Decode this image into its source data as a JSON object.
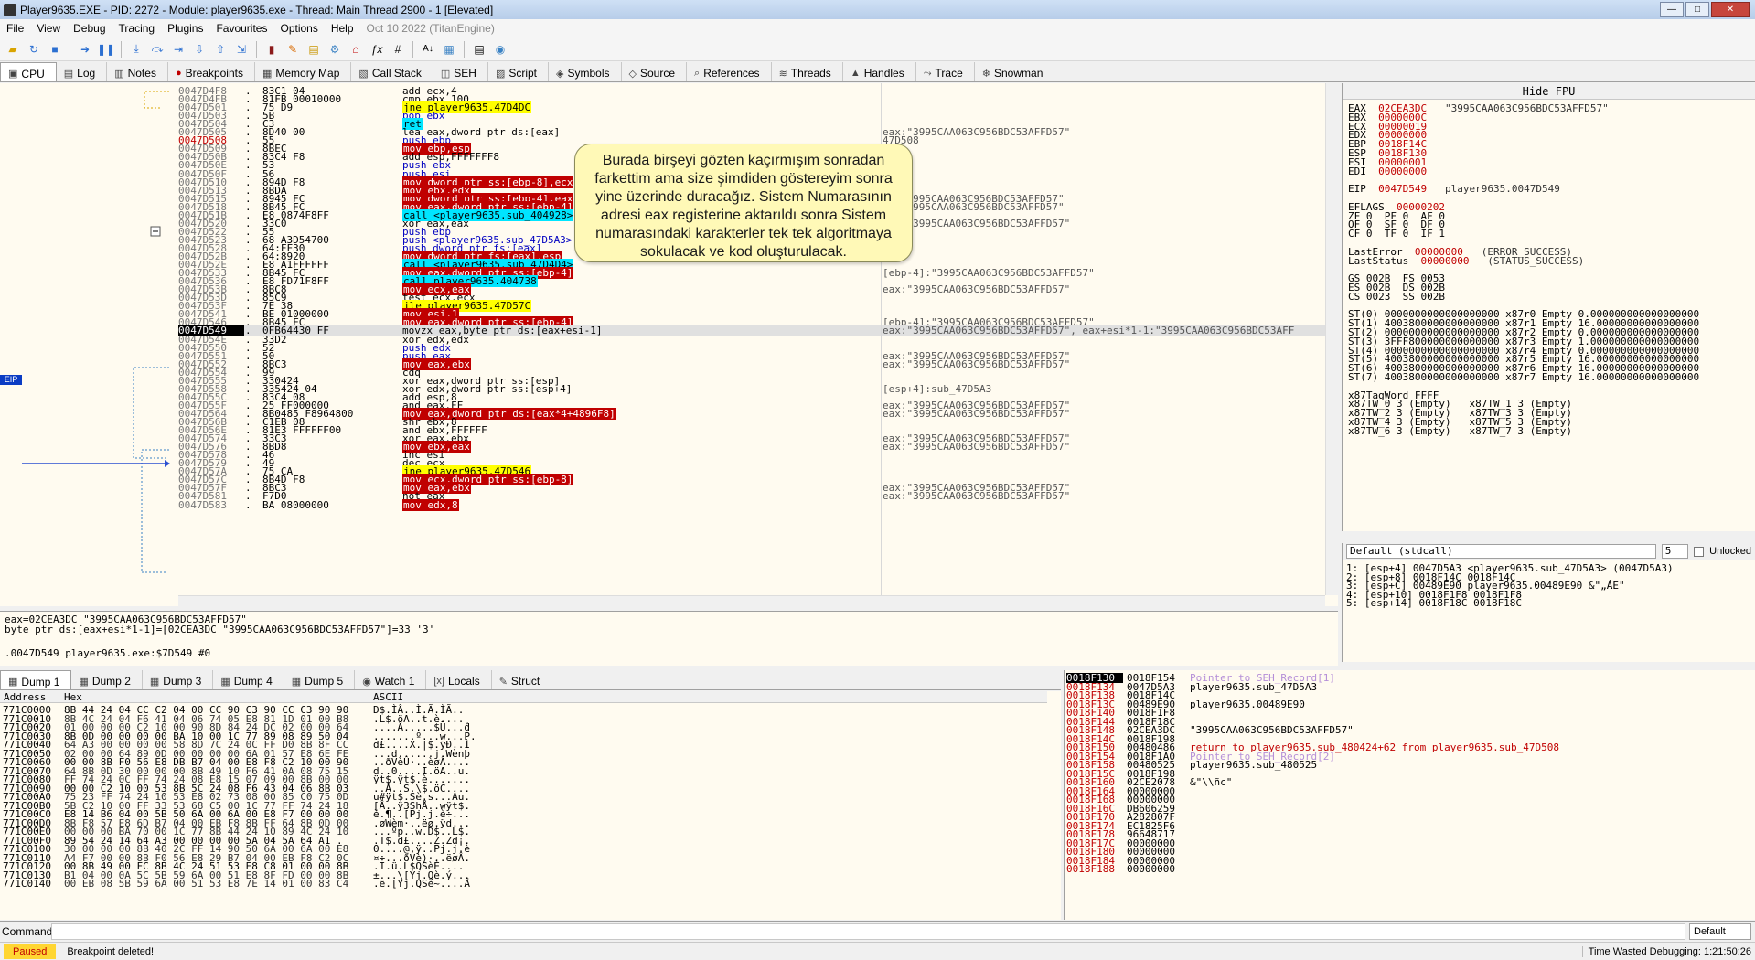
{
  "window": {
    "title": "Player9635.EXE - PID: 2272 - Module: player9635.exe - Thread: Main Thread 2900 - 1 [Elevated]"
  },
  "menu": [
    "File",
    "View",
    "Debug",
    "Tracing",
    "Plugins",
    "Favourites",
    "Options",
    "Help",
    "Oct 10 2022 (TitanEngine)"
  ],
  "tabs": [
    "CPU",
    "Log",
    "Notes",
    "Breakpoints",
    "Memory Map",
    "Call Stack",
    "SEH",
    "Script",
    "Symbols",
    "Source",
    "References",
    "Threads",
    "Handles",
    "Trace",
    "Snowman"
  ],
  "disasm": {
    "eip_label": "EIP",
    "rows": [
      {
        "a": "0047D4F8",
        "b": "83C1 04",
        "i": "add ecx,4",
        "c": ""
      },
      {
        "a": "0047D4FB",
        "b": "81FB 00010000",
        "i": "cmp ebx,100",
        "c": ""
      },
      {
        "a": "0047D501",
        "b": "75 D9",
        "i": "jne player9635.47D4DC",
        "c": "",
        "t": "jmp"
      },
      {
        "a": "0047D503",
        "b": "5B",
        "i": "pop ebx",
        "c": "",
        "t": "push"
      },
      {
        "a": "0047D504",
        "b": "C3",
        "i": "ret",
        "c": "",
        "t": "ret"
      },
      {
        "a": "0047D505",
        "b": "8D40 00",
        "i": "lea eax,dword ptr ds:[eax]",
        "c": "eax:\"3995CAA063C956BDC53AFFD57\""
      },
      {
        "a": "0047D508",
        "b": "55",
        "i": "push ebp",
        "c": "47D508",
        "t": "push",
        "red": true
      },
      {
        "a": "0047D509",
        "b": "8BEC",
        "i": "mov ebp,esp",
        "c": "",
        "t": "mov"
      },
      {
        "a": "0047D50B",
        "b": "83C4 F8",
        "i": "add esp,FFFFFFF8",
        "c": ""
      },
      {
        "a": "0047D50E",
        "b": "53",
        "i": "push ebx",
        "c": "",
        "t": "push"
      },
      {
        "a": "0047D50F",
        "b": "56",
        "i": "push esi",
        "c": "",
        "t": "push"
      },
      {
        "a": "0047D510",
        "b": "894D F8",
        "i": "mov dword ptr ss:[ebp-8],ecx",
        "c": "",
        "t": "mov"
      },
      {
        "a": "0047D513",
        "b": "8BDA",
        "i": "mov ebx,edx",
        "c": "",
        "t": "mov"
      },
      {
        "a": "0047D515",
        "b": "8945 FC",
        "i": "mov dword ptr ss:[ebp-4],eax",
        "c": "4]:\"3995CAA063C956BDC53AFFD57\"",
        "t": "mov"
      },
      {
        "a": "0047D518",
        "b": "8B45 FC",
        "i": "mov eax,dword ptr ss:[ebp-4]",
        "c": "4]:\"3995CAA063C956BDC53AFFD57\"",
        "t": "mov"
      },
      {
        "a": "0047D51B",
        "b": "E8 0874F8FF",
        "i": "call <player9635.sub_404928>",
        "c": "",
        "t": "call"
      },
      {
        "a": "0047D520",
        "b": "33C0",
        "i": "xor eax,eax",
        "c": "eax:\"3995CAA063C956BDC53AFFD57\""
      },
      {
        "a": "0047D522",
        "b": "55",
        "i": "push ebp",
        "c": "",
        "t": "push"
      },
      {
        "a": "0047D523",
        "b": "68 A3D54700",
        "i": "push <player9635.sub_47D5A3>",
        "c": "",
        "t": "push"
      },
      {
        "a": "0047D528",
        "b": "64:FF30",
        "i": "push dword ptr fs:[eax]",
        "c": "",
        "t": "push"
      },
      {
        "a": "0047D52B",
        "b": "64:8920",
        "i": "mov dword ptr fs:[eax],esp",
        "c": "",
        "t": "mov"
      },
      {
        "a": "0047D52E",
        "b": "E8 A1FFFFFF",
        "i": "call <player9635.sub_47D4D4>",
        "c": "",
        "t": "call"
      },
      {
        "a": "0047D533",
        "b": "8B45 FC",
        "i": "mov eax,dword ptr ss:[ebp-4]",
        "c": "[ebp-4]:\"3995CAA063C956BDC53AFFD57\"",
        "t": "mov"
      },
      {
        "a": "0047D536",
        "b": "E8 FD71F8FF",
        "i": "call player9635.404738",
        "c": "",
        "t": "call"
      },
      {
        "a": "0047D53B",
        "b": "8BC8",
        "i": "mov ecx,eax",
        "c": "eax:\"3995CAA063C956BDC53AFFD57\"",
        "t": "mov"
      },
      {
        "a": "0047D53D",
        "b": "85C9",
        "i": "test ecx,ecx",
        "c": ""
      },
      {
        "a": "0047D53F",
        "b": "7E 38",
        "i": "jle player9635.47D57C",
        "c": "",
        "t": "jmp"
      },
      {
        "a": "0047D541",
        "b": "BE 01000000",
        "i": "mov esi,1",
        "c": "",
        "t": "mov"
      },
      {
        "a": "0047D546",
        "b": "8B45 FC",
        "i": "mov eax,dword ptr ss:[ebp-4]",
        "c": "[ebp-4]:\"3995CAA063C956BDC53AFFD57\"",
        "t": "mov"
      },
      {
        "a": "0047D549",
        "b": "0FB64430 FF",
        "i": "movzx eax,byte ptr ds:[eax+esi-1]",
        "c": "eax:\"3995CAA063C956BDC53AFFD57\", eax+esi*1-1:\"3995CAA063C956BDC53AFF",
        "cur": true
      },
      {
        "a": "0047D54E",
        "b": "33D2",
        "i": "xor edx,edx",
        "c": ""
      },
      {
        "a": "0047D550",
        "b": "52",
        "i": "push edx",
        "c": "",
        "t": "push"
      },
      {
        "a": "0047D551",
        "b": "50",
        "i": "push eax",
        "c": "eax:\"3995CAA063C956BDC53AFFD57\"",
        "t": "push"
      },
      {
        "a": "0047D552",
        "b": "8BC3",
        "i": "mov eax,ebx",
        "c": "eax:\"3995CAA063C956BDC53AFFD57\"",
        "t": "mov"
      },
      {
        "a": "0047D554",
        "b": "99",
        "i": "cdq",
        "c": ""
      },
      {
        "a": "0047D555",
        "b": "330424",
        "i": "xor eax,dword ptr ss:[esp]",
        "c": ""
      },
      {
        "a": "0047D558",
        "b": "335424 04",
        "i": "xor edx,dword ptr ss:[esp+4]",
        "c": "[esp+4]:sub_47D5A3"
      },
      {
        "a": "0047D55C",
        "b": "83C4 08",
        "i": "add esp,8",
        "c": ""
      },
      {
        "a": "0047D55F",
        "b": "25 FF000000",
        "i": "and eax,FF",
        "c": "eax:\"3995CAA063C956BDC53AFFD57\""
      },
      {
        "a": "0047D564",
        "b": "8B0485 F8964800",
        "i": "mov eax,dword ptr ds:[eax*4+4896F8]",
        "c": "eax:\"3995CAA063C956BDC53AFFD57\"",
        "t": "mov"
      },
      {
        "a": "0047D56B",
        "b": "C1EB 08",
        "i": "shr ebx,8",
        "c": ""
      },
      {
        "a": "0047D56E",
        "b": "81E3 FFFFFF00",
        "i": "and ebx,FFFFFF",
        "c": ""
      },
      {
        "a": "0047D574",
        "b": "33C3",
        "i": "xor eax,ebx",
        "c": "eax:\"3995CAA063C956BDC53AFFD57\""
      },
      {
        "a": "0047D576",
        "b": "8BD8",
        "i": "mov ebx,eax",
        "c": "eax:\"3995CAA063C956BDC53AFFD57\"",
        "t": "mov"
      },
      {
        "a": "0047D578",
        "b": "46",
        "i": "inc esi",
        "c": ""
      },
      {
        "a": "0047D579",
        "b": "49",
        "i": "dec ecx",
        "c": ""
      },
      {
        "a": "0047D57A",
        "b": "75 CA",
        "i": "jne player9635.47D546",
        "c": "",
        "t": "jmp"
      },
      {
        "a": "0047D57C",
        "b": "8B4D F8",
        "i": "mov ecx,dword ptr ss:[ebp-8]",
        "c": "",
        "t": "mov"
      },
      {
        "a": "0047D57F",
        "b": "8BC3",
        "i": "mov eax,ebx",
        "c": "eax:\"3995CAA063C956BDC53AFFD57\"",
        "t": "mov"
      },
      {
        "a": "0047D581",
        "b": "F7D0",
        "i": "not eax",
        "c": "eax:\"3995CAA063C956BDC53AFFD57\""
      },
      {
        "a": "0047D583",
        "b": "BA 08000000",
        "i": "mov edx,8",
        "c": "",
        "t": "mov"
      }
    ]
  },
  "callout": {
    "text": "Burada birşeyi gözten kaçırmışım sonradan farkettim ama size şimdiden göstereyim sonra yine üzerinde duracağız. Sistem Numarasının adresi eax registerine aktarıldı sonra Sistem numarasındaki karakterler tek tek algoritmaya sokulacak ve kod oluşturulacak."
  },
  "registers": {
    "hide_fpu": "Hide FPU",
    "lines": [
      [
        "EAX",
        "02CEA3DC",
        "\"3995CAA063C956BDC53AFFD57\""
      ],
      [
        "EBX",
        "0000000C",
        ""
      ],
      [
        "ECX",
        "00000019",
        ""
      ],
      [
        "EDX",
        "00000000",
        ""
      ],
      [
        "EBP",
        "0018F14C",
        ""
      ],
      [
        "ESP",
        "0018F130",
        ""
      ],
      [
        "ESI",
        "00000001",
        ""
      ],
      [
        "EDI",
        "00000000",
        ""
      ],
      [
        "",
        "",
        ""
      ],
      [
        "EIP",
        "0047D549",
        "player9635.0047D549"
      ],
      [
        "",
        "",
        ""
      ],
      [
        "EFLAGS",
        "00000202",
        ""
      ],
      [
        "ZF 0  PF 0  AF 0",
        "",
        ""
      ],
      [
        "OF 0  SF 0  DF 0",
        "",
        ""
      ],
      [
        "CF 0  TF 0  IF 1",
        "",
        ""
      ],
      [
        "",
        "",
        ""
      ],
      [
        "LastError",
        "00000000",
        "(ERROR_SUCCESS)"
      ],
      [
        "LastStatus",
        "00000000",
        "(STATUS_SUCCESS)"
      ],
      [
        "",
        "",
        ""
      ],
      [
        "GS 002B  FS 0053",
        "",
        ""
      ],
      [
        "ES 002B  DS 002B",
        "",
        ""
      ],
      [
        "CS 0023  SS 002B",
        "",
        ""
      ],
      [
        "",
        "",
        ""
      ],
      [
        "ST(0) 0000000000000000000 x87r0 Empty 0.000000000000000000",
        "",
        ""
      ],
      [
        "ST(1) 4003800000000000000 x87r1 Empty 16.00000000000000000",
        "",
        ""
      ],
      [
        "ST(2) 0000000000000000000 x87r2 Empty 0.000000000000000000",
        "",
        ""
      ],
      [
        "ST(3) 3FFF800000000000000 x87r3 Empty 1.000000000000000000",
        "",
        ""
      ],
      [
        "ST(4) 0000000000000000000 x87r4 Empty 0.000000000000000000",
        "",
        ""
      ],
      [
        "ST(5) 4003800000000000000 x87r5 Empty 16.00000000000000000",
        "",
        ""
      ],
      [
        "ST(6) 4003800000000000000 x87r6 Empty 16.00000000000000000",
        "",
        ""
      ],
      [
        "ST(7) 4003800000000000000 x87r7 Empty 16.00000000000000000",
        "",
        ""
      ],
      [
        "",
        "",
        ""
      ],
      [
        "x87TagWord FFFF",
        "",
        ""
      ],
      [
        "x87TW_0 3 (Empty)   x87TW_1 3 (Empty)",
        "",
        ""
      ],
      [
        "x87TW_2 3 (Empty)   x87TW_3 3 (Empty)",
        "",
        ""
      ],
      [
        "x87TW_4 3 (Empty)   x87TW_5 3 (Empty)",
        "",
        ""
      ],
      [
        "x87TW_6 3 (Empty)   x87TW_7 3 (Empty)",
        "",
        ""
      ]
    ]
  },
  "callconv": {
    "selected": "Default (stdcall)",
    "count": "5",
    "unlocked": "Unlocked",
    "lines": [
      "1: [esp+4] 0047D5A3 <player9635.sub_47D5A3> (0047D5A3)",
      "2: [esp+8] 0018F14C 0018F14C",
      "3: [esp+C] 00489E90 player9635.00489E90 &\"„ÁE\"",
      "4: [esp+10] 0018F1F8 0018F1F8",
      "5: [esp+14] 0018F18C 0018F18C"
    ]
  },
  "info": {
    "line1": "eax=02CEA3DC \"3995CAA063C956BDC53AFFD57\"",
    "line2": "byte ptr ds:[eax+esi*1-1]=[02CEA3DC \"3995CAA063C956BDC53AFFD57\"]=33 '3'",
    "line3": ".0047D549 player9635.exe:$7D549 #0"
  },
  "dump_tabs": [
    "Dump 1",
    "Dump 2",
    "Dump 3",
    "Dump 4",
    "Dump 5",
    "Watch 1",
    "Locals",
    "Struct"
  ],
  "dump": {
    "hdr_addr": "Address",
    "hdr_hex": "Hex",
    "hdr_ascii": "ASCII",
    "rows": [
      [
        "771C0000",
        "8B 44 24 04 CC C2 04 00 CC 90 C3 90 CC C3 90 90",
        "D$.ÌÂ..Ì.Ã.ÌÃ.."
      ],
      [
        "771C0010",
        "8B 4C 24 04 F6 41 04 06 74 05 E8 81 1D 01 00 B8",
        ".L$.öA..t.è....¸"
      ],
      [
        "771C0020",
        "01 00 00 00 C2 10 00 90 8D 84 24 DC 02 00 00 64",
        "....Â.....$Ü...d"
      ],
      [
        "771C0030",
        "8B 0D 00 00 00 00 BA 10 00 1C 77 89 08 89 50 04",
        ".......º...w...P."
      ],
      [
        "771C0040",
        "64 A3 00 00 00 00 58 8D 7C 24 0C FF D0 8B 8F CC",
        "d£....X.|$.ÿÐ..Ì"
      ],
      [
        "771C0050",
        "02 00 00 64 89 0D 00 00 00 00 6A 01 57 E8 6E FE",
        "...d......j.Wènþ"
      ],
      [
        "771C0060",
        "00 00 8B F0 56 E8 DB B7 04 00 E8 F8 C2 10 00 90",
        "..ðVèÛ·..èøÂ...."
      ],
      [
        "771C0070",
        "64 8B 0D 30 00 00 00 8B 49 10 F6 41 0A 08 75 15",
        "d..0....I.öA..u."
      ],
      [
        "771C0080",
        "FF 74 24 0C FF 74 24 08 E8 15 07 09 00 8B 00 00",
        "ÿt$.ÿt$.è......."
      ],
      [
        "771C0090",
        "00 00 C2 10 00 53 8B 5C 24 08 F6 43 04 06 8B 03",
        "..Â..S.\\$.öC...."
      ],
      [
        "771C00A0",
        "75 23 FF 74 24 10 53 E8 02 73 08 00 85 C0 75 0D",
        "u#ÿt$.Sè.s...Àu."
      ],
      [
        "771C00B0",
        "5B C2 10 00 FF 33 53 68 C5 00 1C 77 FF 74 24 18",
        "[Â..ÿ3ShÅ..wÿt$."
      ],
      [
        "771C00C0",
        "E8 14 B6 04 00 5B 50 6A 00 6A 00 E8 F7 00 00 00",
        "è.¶..[Pj.j.è÷..."
      ],
      [
        "771C00D0",
        "8B F8 57 E8 6D B7 04 00 EB F8 8B FF 64 8B 0D 00",
        ".øWèm·..ëø.ÿd..."
      ],
      [
        "771C00E0",
        "00 00 00 BA 70 00 1C 77 8B 44 24 10 89 4C 24 10",
        "...ºp..w.D$..L$."
      ],
      [
        "771C00F0",
        "89 54 24 14 64 A3 00 00 00 00 5A 04 5A 64 A1 .",
        ".T$.d£....Z.Zd¡."
      ],
      [
        "771C0100",
        "30 00 00 00 8B 40 2C FF 14 90 50 6A 00 6A 00 E8",
        "0....@,ÿ..Pj.j.è"
      ],
      [
        "771C0110",
        "A4 F7 00 00 8B F0 56 E8 29 B7 04 00 EB F8 C2 0C",
        "¤÷...ðVè)·..ëøÂ."
      ],
      [
        "771C0120",
        "00 8B 49 00 FC 8B 4C 24 51 53 E8 C8 01 00 00 8B",
        ".I.ü.L$QSèÈ...."
      ],
      [
        "771C0130",
        "B1 04 00 0A 5C 5B 59 6A 00 51 E8 8F FD 00 00 8B",
        "±...\\[Yj.Qè.ý..."
      ],
      [
        "771C0140",
        "00 EB 08 5B 59 6A 00 51 53 E8 7E 14 01 00 83 C4",
        ".ë.[Yj.QSè~....Ä"
      ]
    ]
  },
  "stack": {
    "rows": [
      [
        "0018F130",
        "0018F154",
        "Pointer to SEH_Record[1]",
        "seh"
      ],
      [
        "0018F134",
        "0047D5A3",
        "player9635.sub_47D5A3",
        ""
      ],
      [
        "0018F138",
        "0018F14C",
        "",
        ""
      ],
      [
        "0018F13C",
        "00489E90",
        "player9635.00489E90",
        ""
      ],
      [
        "0018F140",
        "0018F1F8",
        "",
        ""
      ],
      [
        "0018F144",
        "0018F18C",
        "",
        ""
      ],
      [
        "0018F148",
        "02CEA3DC",
        "\"3995CAA063C956BDC53AFFD57\"",
        ""
      ],
      [
        "0018F14C",
        "0018F198",
        "",
        ""
      ],
      [
        "0018F150",
        "00480486",
        "return to player9635.sub_480424+62 from player9635.sub_47D508",
        "ret"
      ],
      [
        "0018F154",
        "0018F1A0",
        "Pointer to SEH_Record[2]",
        "seh"
      ],
      [
        "0018F158",
        "00480525",
        "player9635.sub_480525",
        ""
      ],
      [
        "0018F15C",
        "0018F198",
        "",
        ""
      ],
      [
        "0018F160",
        "02CE2078",
        "&\"\\\\ñc\"",
        ""
      ],
      [
        "0018F164",
        "00000000",
        "",
        ""
      ],
      [
        "0018F168",
        "00000000",
        "",
        ""
      ],
      [
        "0018F16C",
        "DB606259",
        "",
        ""
      ],
      [
        "0018F170",
        "A282807F",
        "",
        ""
      ],
      [
        "0018F174",
        "EC1825F6",
        "",
        ""
      ],
      [
        "0018F178",
        "96648717",
        "",
        ""
      ],
      [
        "0018F17C",
        "00000000",
        "",
        ""
      ],
      [
        "0018F180",
        "00000000",
        "",
        ""
      ],
      [
        "0018F184",
        "00000000",
        "",
        ""
      ],
      [
        "0018F188",
        "00000000",
        "",
        ""
      ]
    ]
  },
  "command": {
    "label": "Command:",
    "dropdown": "Default"
  },
  "status": {
    "state": "Paused",
    "message": "Breakpoint deleted!",
    "time": "Time Wasted Debugging: 1:21:50:26"
  }
}
